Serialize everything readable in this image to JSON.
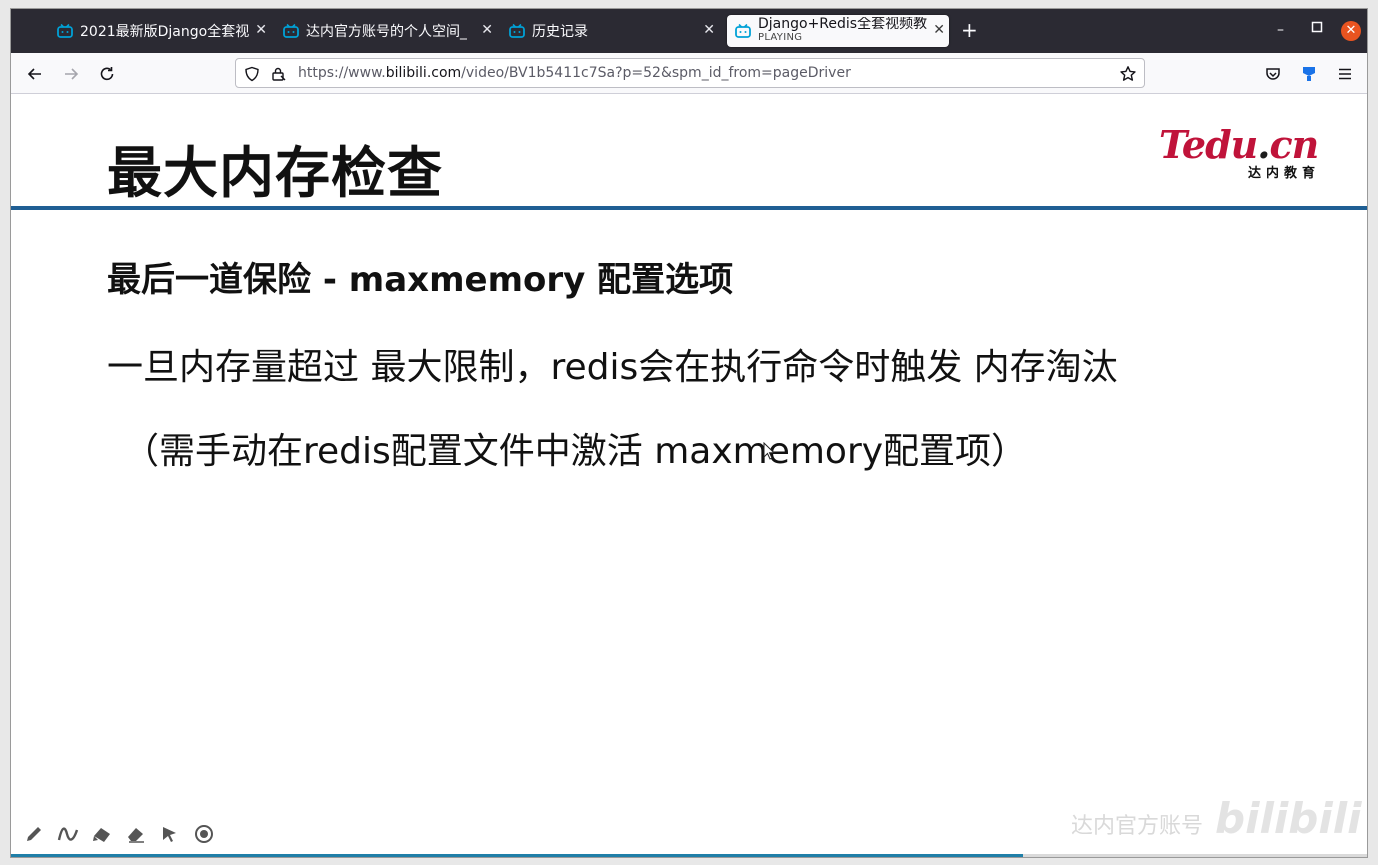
{
  "tabs": [
    {
      "label": "2021最新版Django全套视",
      "active": false
    },
    {
      "label": "达内官方账号的个人空间_",
      "active": false
    },
    {
      "label": "历史记录",
      "active": false
    },
    {
      "label": "Django+Redis全套视频教",
      "sublabel": "PLAYING",
      "active": true
    }
  ],
  "toolbar": {
    "url_prefix": "https://www.",
    "url_domain": "bilibili.com",
    "url_suffix": "/video/BV1b5411c7Sa?p=52&spm_id_from=pageDriver"
  },
  "slide": {
    "title": "最大内存检查",
    "logo_text": "Tedu",
    "logo_dot": ".",
    "logo_cn": "cn",
    "logo_chinese": "达内教育",
    "subheading": "最后一道保险 - maxmemory 配置选项",
    "line1": "一旦内存量超过 最大限制，redis会在执行命令时触发 内存淘汰",
    "line2": "（需手动在redis配置文件中激活 maxmemory配置项）"
  },
  "watermark": {
    "text": "达内官方账号",
    "brand": "bilibili"
  },
  "player": {
    "progress_fraction": 0.745
  },
  "colors": {
    "accent": "#1f5f94",
    "brand_red": "#c0133a",
    "bili_blue": "#00a1d6"
  },
  "icons": [
    "bilibili-tab-icon",
    "back-icon",
    "forward-icon",
    "reload-icon",
    "shield-icon",
    "lock-icon",
    "star-icon",
    "pocket-icon",
    "extension-icon",
    "menu-icon",
    "pen-icon",
    "curve-icon",
    "highlighter-icon",
    "eraser-icon",
    "pointer-icon",
    "record-icon"
  ]
}
